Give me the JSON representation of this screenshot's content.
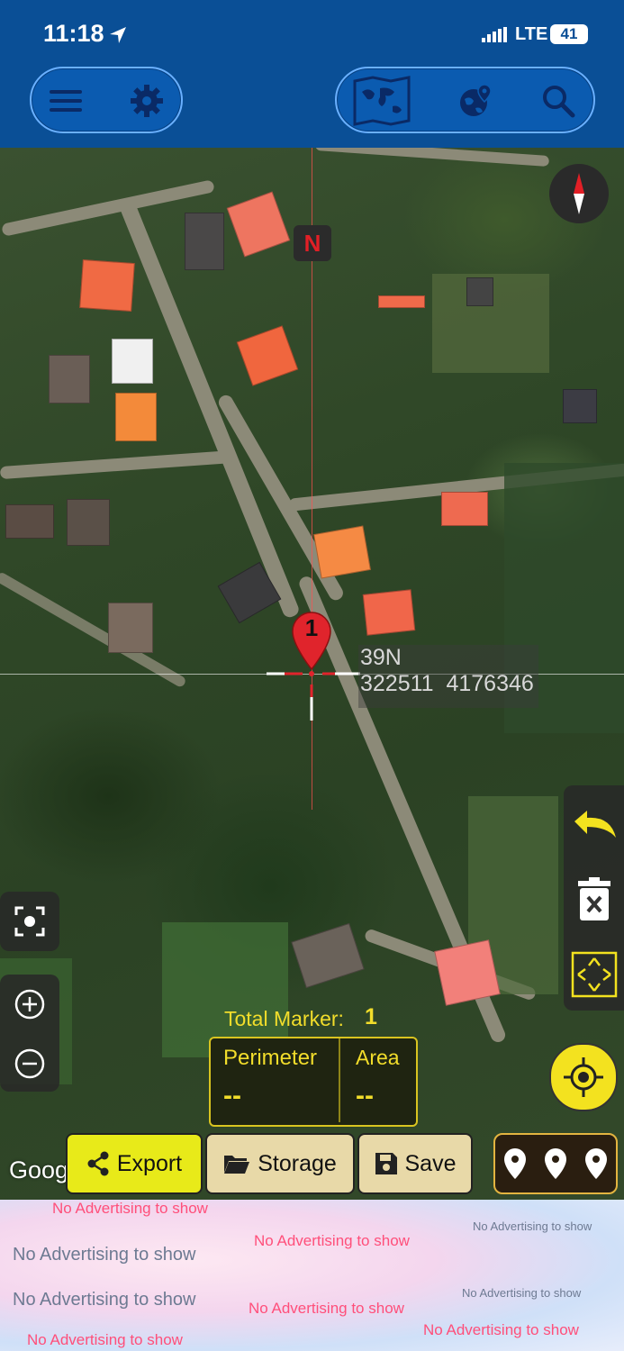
{
  "status_bar": {
    "time": "11:18",
    "network": "LTE",
    "battery": "41"
  },
  "toolbar": {
    "menu_icon": "hamburger-menu-icon",
    "settings_icon": "gear-icon",
    "map_type_icon": "world-map-icon",
    "globe_icon": "globe-pin-icon",
    "search_icon": "search-icon"
  },
  "map": {
    "north_label": "N",
    "marker_number": "1",
    "zone": "39N",
    "coordinates": "322511  4176346",
    "provider_logo": "Google Maps"
  },
  "stats": {
    "total_marker_label": "Total Marker:",
    "total_marker_value": "1",
    "perimeter_label": "Perimeter",
    "perimeter_value": "--",
    "area_label": "Area",
    "area_value": "--"
  },
  "actions": {
    "export_label": "Export",
    "storage_label": "Storage",
    "save_label": "Save"
  },
  "ads": {
    "text": "No Advertising to show"
  },
  "colors": {
    "toolbar_bg": "#0a4f96",
    "accent_yellow": "#e8ea19",
    "marker_red": "#e0242c"
  }
}
